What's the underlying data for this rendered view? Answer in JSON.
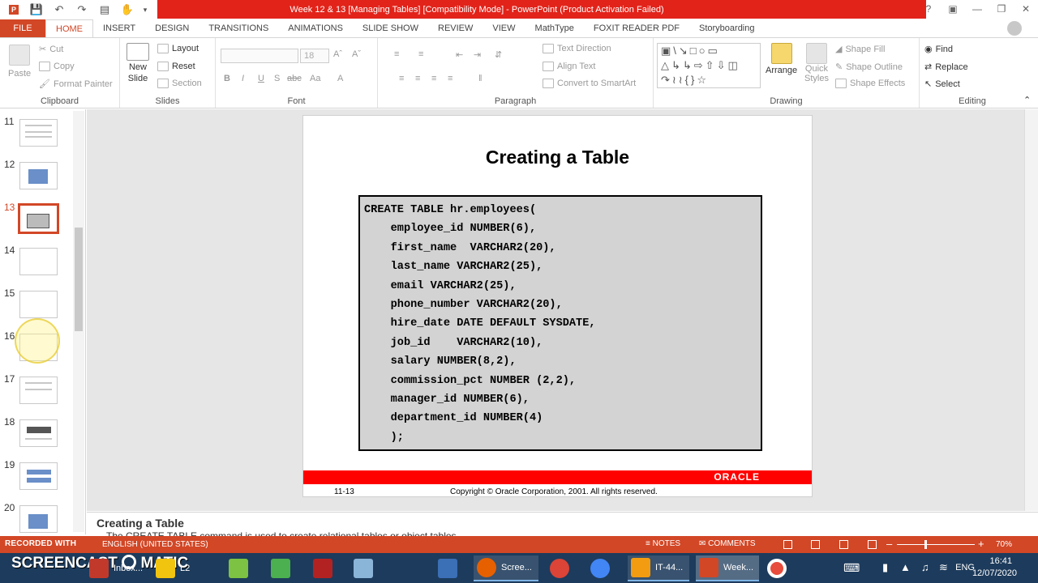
{
  "window": {
    "title": "Week 12 & 13 [Managing Tables] [Compatibility Mode] -  PowerPoint (Product Activation Failed)"
  },
  "tabs": [
    "FILE",
    "HOME",
    "INSERT",
    "DESIGN",
    "TRANSITIONS",
    "ANIMATIONS",
    "SLIDE SHOW",
    "REVIEW",
    "VIEW",
    "MathType",
    "FOXIT READER PDF",
    "Storyboarding"
  ],
  "active_tab": "HOME",
  "ribbon": {
    "clipboard": {
      "paste": "Paste",
      "cut": "Cut",
      "copy": "Copy",
      "format_painter": "Format Painter",
      "label": "Clipboard"
    },
    "slides": {
      "new_slide": "New",
      "new_slide2": "Slide",
      "layout": "Layout",
      "reset": "Reset",
      "section": "Section",
      "label": "Slides"
    },
    "font": {
      "size": "18",
      "label": "Font",
      "bold": "B",
      "italic": "I",
      "underline": "U",
      "strike": "S",
      "spacing": "abc",
      "case": "Aa",
      "color": "A"
    },
    "paragraph": {
      "text_direction": "Text Direction",
      "align_text": "Align Text",
      "convert_smartart": "Convert to SmartArt",
      "label": "Paragraph"
    },
    "drawing": {
      "arrange": "Arrange",
      "quick_styles": "Quick",
      "quick_styles2": "Styles",
      "shape_fill": "Shape Fill",
      "shape_outline": "Shape Outline",
      "shape_effects": "Shape Effects",
      "label": "Drawing"
    },
    "editing": {
      "find": "Find",
      "replace": "Replace",
      "select": "Select",
      "label": "Editing"
    }
  },
  "thumbnails": [
    {
      "num": "11"
    },
    {
      "num": "12"
    },
    {
      "num": "13"
    },
    {
      "num": "14"
    },
    {
      "num": "15"
    },
    {
      "num": "16"
    },
    {
      "num": "17"
    },
    {
      "num": "18"
    },
    {
      "num": "19"
    },
    {
      "num": "20"
    }
  ],
  "selected_slide": "13",
  "slide": {
    "title": "Creating a Table",
    "code_lines": [
      "CREATE TABLE hr.employees(",
      "    employee_id NUMBER(6),",
      "    first_name  VARCHAR2(20),",
      "    last_name VARCHAR2(25),",
      "    email VARCHAR2(25),",
      "    phone_number VARCHAR2(20),",
      "    hire_date DATE DEFAULT SYSDATE,",
      "    job_id    VARCHAR2(10),",
      "    salary NUMBER(8,2),",
      "    commission_pct NUMBER (2,2),",
      "    manager_id NUMBER(6),",
      "    department_id NUMBER(4)",
      "    );"
    ],
    "footer_logo": "ORACLE",
    "slide_number": "11-13",
    "copyright": "Copyright © Oracle Corporation, 2001. All rights reserved."
  },
  "notes": {
    "title": "Creating a Table",
    "text": "The CREATE TABLE command is used to create relational tables or object tables."
  },
  "statusbar": {
    "recorded": "RECORDED WITH",
    "language": "ENGLISH (UNITED STATES)",
    "notes": "NOTES",
    "comments": "COMMENTS",
    "zoom": "70%"
  },
  "taskbar": {
    "screencast": "SCREENCAST",
    "screencast2": "MATIC",
    "apps": [
      {
        "label": "Inbox...",
        "color": "#c0392b"
      },
      {
        "label": "L2",
        "color": "#f1c40f"
      },
      {
        "label": "",
        "color": "#7dc242"
      },
      {
        "label": "",
        "color": "#4caf50"
      },
      {
        "label": "",
        "color": "#b22222"
      },
      {
        "label": "",
        "color": "#8ab4d8"
      },
      {
        "label": "",
        "color": "#3b6fb6"
      },
      {
        "label": "Scree...",
        "color": "#e66000"
      },
      {
        "label": "",
        "color": "#db4437"
      },
      {
        "label": "",
        "color": "#4285f4"
      },
      {
        "label": "IT-44...",
        "color": "#f39c12"
      },
      {
        "label": "Week...",
        "color": "#d24726"
      },
      {
        "label": "",
        "color": "#e74c3c"
      }
    ],
    "lang": "ENG",
    "time": "16:41",
    "date": "12/07/2020"
  }
}
